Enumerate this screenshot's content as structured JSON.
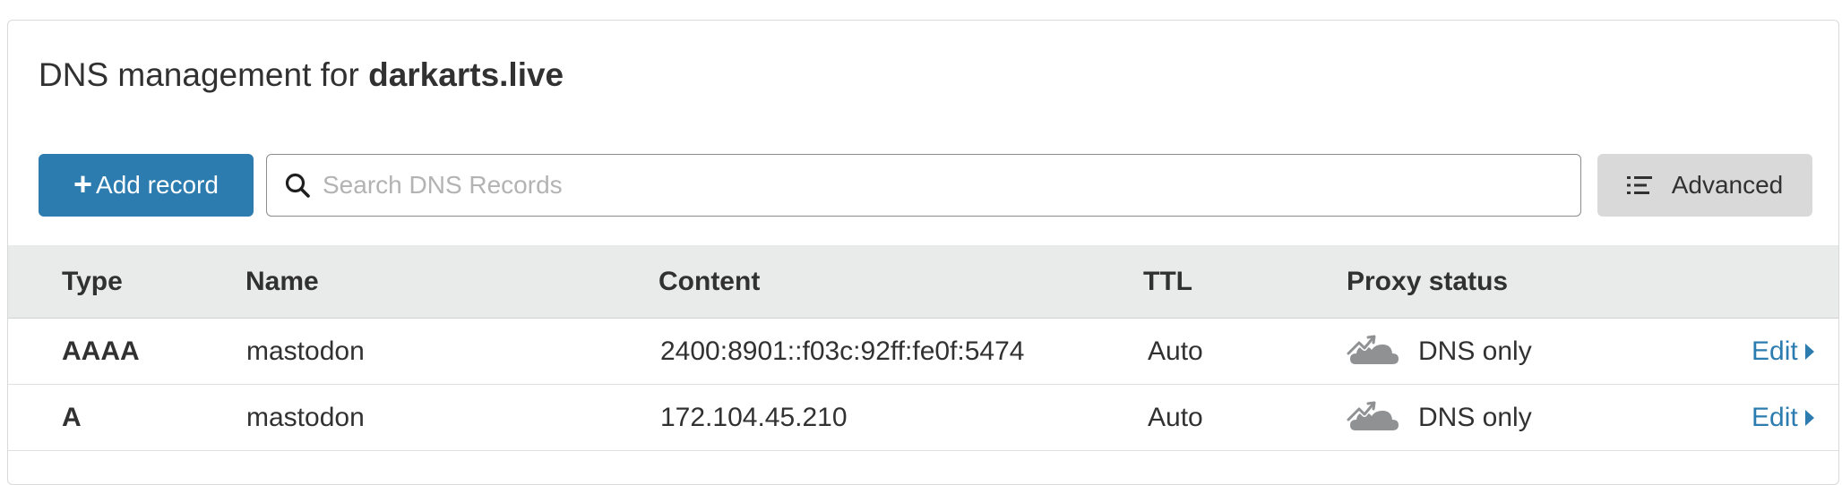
{
  "header": {
    "title_prefix": "DNS management for ",
    "domain": "darkarts.live"
  },
  "toolbar": {
    "add_label": "Add record",
    "add_prefix": "+",
    "search_placeholder": "Search DNS Records",
    "search_value": "",
    "advanced_label": "Advanced"
  },
  "table": {
    "columns": [
      "Type",
      "Name",
      "Content",
      "TTL",
      "Proxy status"
    ],
    "rows": [
      {
        "type": "AAAA",
        "name": "mastodon",
        "content": "2400:8901::f03c:92ff:fe0f:5474",
        "ttl": "Auto",
        "proxy": "DNS only",
        "action": "Edit"
      },
      {
        "type": "A",
        "name": "mastodon",
        "content": "172.104.45.210",
        "ttl": "Auto",
        "proxy": "DNS only",
        "action": "Edit"
      }
    ]
  },
  "icons": {
    "search": "search-icon",
    "advanced": "filter-list-icon",
    "proxy": "dns-only-cloud-icon",
    "edit": "caret-right-icon"
  },
  "colors": {
    "primary": "#2c7cb0",
    "header_bg": "#e9ebea",
    "button_gray": "#d9d9d9",
    "cloud_gray": "#8f9192"
  }
}
